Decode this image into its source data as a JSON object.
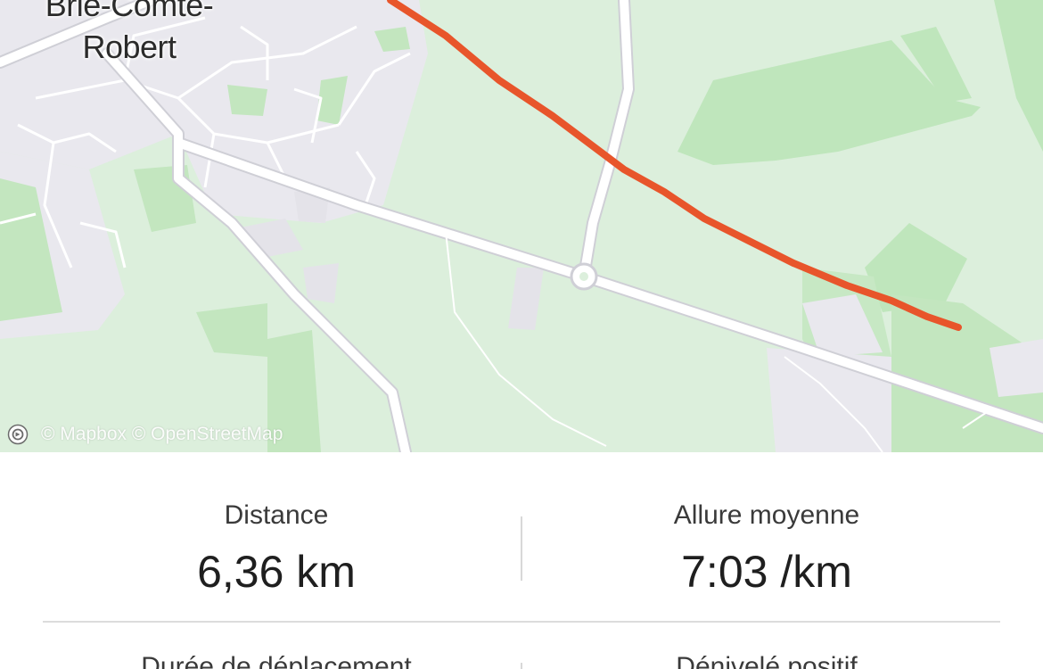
{
  "map": {
    "place_name_line1": "Brie-Comte-",
    "place_name_line2": "Robert",
    "attribution": "© Mapbox © OpenStreetMap",
    "route_color": "#e8552b",
    "logo_icon": "mapbox-logo-icon"
  },
  "stats": {
    "distance": {
      "label": "Distance",
      "value": "6,36 km"
    },
    "pace": {
      "label": "Allure moyenne",
      "value": "7:03 /km"
    },
    "moving_time": {
      "label": "Durée de déplacement",
      "value": ""
    },
    "elevation_gain": {
      "label": "Dénivelé positif",
      "value": ""
    }
  },
  "colors": {
    "map_background": "#dcefdc",
    "park_green": "#bfe6bc",
    "urban_gray": "#e7e7ec",
    "road_white": "#ffffff",
    "text_primary": "#1f1f1f"
  }
}
